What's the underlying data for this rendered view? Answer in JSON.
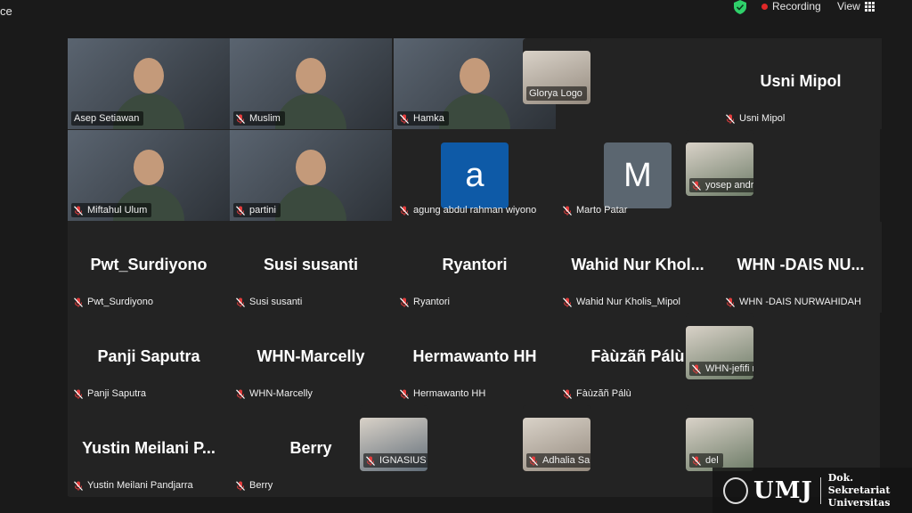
{
  "app": {
    "title_fragment": "ce"
  },
  "topbar": {
    "recording_label": "Recording",
    "view_label": "View"
  },
  "colors": {
    "active_speaker": "#2fd06a",
    "recording_dot": "#e02828",
    "muted_icon": "#e43c3c"
  },
  "participants": [
    {
      "display_name": "Asep Setiawan",
      "big_name": "",
      "kind": "video",
      "active": true,
      "muted": false
    },
    {
      "display_name": "Muslim",
      "big_name": "",
      "kind": "video",
      "muted": true
    },
    {
      "display_name": "Hamka",
      "big_name": "",
      "kind": "video",
      "muted": true
    },
    {
      "display_name": "Glorya Logo",
      "big_name": "",
      "kind": "photo",
      "muted": false
    },
    {
      "display_name": "Usni Mipol",
      "big_name": "Usni Mipol",
      "kind": "namecard",
      "muted": true
    },
    {
      "display_name": "Miftahul Ulum",
      "big_name": "",
      "kind": "video",
      "muted": true
    },
    {
      "display_name": "partini",
      "big_name": "",
      "kind": "video",
      "muted": true
    },
    {
      "display_name": "agung abdul rahman wiyono",
      "big_name": "",
      "kind": "avatar",
      "avatar_letter": "a",
      "avatar_color": "#0e5aa7",
      "muted": true
    },
    {
      "display_name": "Marto Patar",
      "big_name": "",
      "kind": "avatar",
      "avatar_letter": "M",
      "avatar_color": "#5b6670",
      "muted": true
    },
    {
      "display_name": "yosep andriana",
      "big_name": "",
      "kind": "photo",
      "muted": true
    },
    {
      "display_name": "Pwt_Surdiyono",
      "big_name": "Pwt_Surdiyono",
      "kind": "namecard",
      "muted": true
    },
    {
      "display_name": "Susi susanti",
      "big_name": "Susi susanti",
      "kind": "namecard",
      "muted": true
    },
    {
      "display_name": "Ryantori",
      "big_name": "Ryantori",
      "kind": "namecard",
      "muted": true
    },
    {
      "display_name": "Wahid Nur Kholis_Mipol",
      "big_name": "Wahid Nur Khol...",
      "kind": "namecard",
      "muted": true
    },
    {
      "display_name": "WHN -DAIS NURWAHIDAH",
      "big_name": "WHN -DAIS NU...",
      "kind": "namecard",
      "muted": true
    },
    {
      "display_name": "Panji Saputra",
      "big_name": "Panji Saputra",
      "kind": "namecard",
      "muted": true
    },
    {
      "display_name": "WHN-Marcelly",
      "big_name": "WHN-Marcelly",
      "kind": "namecard",
      "muted": true
    },
    {
      "display_name": "Hermawanto HH",
      "big_name": "Hermawanto HH",
      "kind": "namecard",
      "muted": true
    },
    {
      "display_name": "Fàùzãñ Pálù",
      "big_name": "Fàùzãñ Pálù",
      "kind": "namecard",
      "muted": true
    },
    {
      "display_name": "WHN-jefifi milda Tobe",
      "big_name": "",
      "kind": "photo",
      "muted": true
    },
    {
      "display_name": "Yustin Meilani Pandjarra",
      "big_name": "Yustin Meilani P...",
      "kind": "namecard",
      "muted": true
    },
    {
      "display_name": "Berry",
      "big_name": "Berry",
      "kind": "namecard",
      "muted": true
    },
    {
      "display_name": "IGNASIUS HARTONO MATTH...",
      "big_name": "",
      "kind": "photo",
      "muted": true
    },
    {
      "display_name": "Adhalia Saputri",
      "big_name": "",
      "kind": "photo",
      "muted": true
    },
    {
      "display_name": "del",
      "big_name": "",
      "kind": "photo",
      "muted": true
    }
  ],
  "watermark": {
    "logo": "UMJ",
    "line1": "Dok. Sekretariat",
    "line2": "Universitas"
  }
}
